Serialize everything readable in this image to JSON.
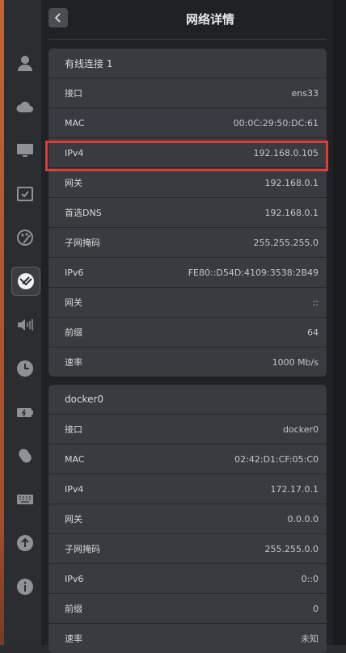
{
  "header": {
    "title": "网络详情"
  },
  "sidebar": {
    "icons": [
      "account-icon",
      "cloud-icon",
      "display-icon",
      "default-apps-icon",
      "personalization-icon",
      "network-icon",
      "sound-icon",
      "datetime-icon",
      "power-icon",
      "mouse-icon",
      "keyboard-icon",
      "update-icon",
      "info-icon"
    ],
    "active": "network-icon"
  },
  "groups": [
    {
      "title": "有线连接 1",
      "rows": [
        {
          "label": "接口",
          "value": "ens33"
        },
        {
          "label": "MAC",
          "value": "00:0C:29:50:DC:61"
        },
        {
          "label": "IPv4",
          "value": "192.168.0.105"
        },
        {
          "label": "网关",
          "value": "192.168.0.1"
        },
        {
          "label": "首选DNS",
          "value": "192.168.0.1"
        },
        {
          "label": "子网掩码",
          "value": "255.255.255.0"
        },
        {
          "label": "IPv6",
          "value": "FE80::D54D:4109:3538:2B49"
        },
        {
          "label": "网关",
          "value": "::"
        },
        {
          "label": "前缀",
          "value": "64"
        },
        {
          "label": "速率",
          "value": "1000 Mb/s"
        }
      ]
    },
    {
      "title": "docker0",
      "rows": [
        {
          "label": "接口",
          "value": "docker0"
        },
        {
          "label": "MAC",
          "value": "02:42:D1:CF:05:C0"
        },
        {
          "label": "IPv4",
          "value": "172.17.0.1"
        },
        {
          "label": "网关",
          "value": "0.0.0.0"
        },
        {
          "label": "子网掩码",
          "value": "255.255.0.0"
        },
        {
          "label": "IPv6",
          "value": "0::0"
        },
        {
          "label": "前缀",
          "value": "0"
        },
        {
          "label": "速率",
          "value": "未知"
        }
      ]
    }
  ],
  "highlight_color": "#e53935"
}
